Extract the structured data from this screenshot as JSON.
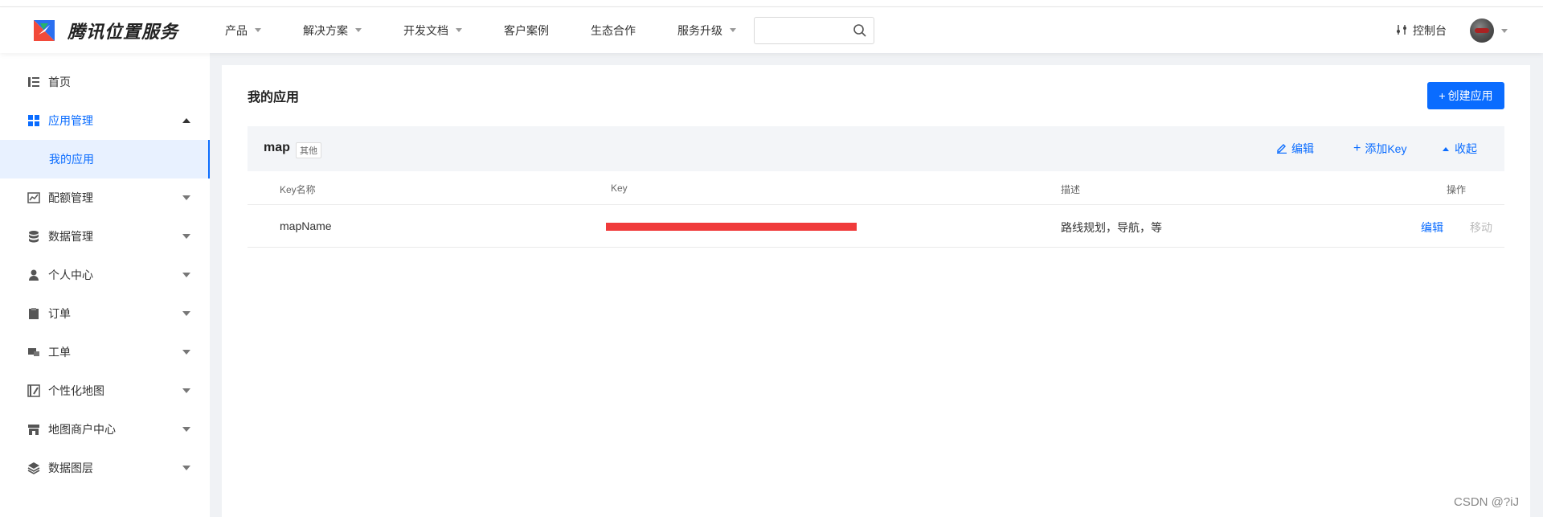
{
  "header": {
    "brand": "腾讯位置服务",
    "nav": [
      {
        "label": "产品",
        "dropdown": true
      },
      {
        "label": "解决方案",
        "dropdown": true
      },
      {
        "label": "开发文档",
        "dropdown": true
      },
      {
        "label": "客户案例",
        "dropdown": false
      },
      {
        "label": "生态合作",
        "dropdown": false
      },
      {
        "label": "服务升级",
        "dropdown": true
      }
    ],
    "search_value": "",
    "console_label": "控制台"
  },
  "sidebar": {
    "items": [
      {
        "label": "首页",
        "icon": "list-icon"
      },
      {
        "label": "应用管理",
        "icon": "grid-icon"
      },
      {
        "label": "我的应用"
      },
      {
        "label": "配额管理",
        "icon": "chart-icon"
      },
      {
        "label": "数据管理",
        "icon": "database-icon"
      },
      {
        "label": "个人中心",
        "icon": "user-icon"
      },
      {
        "label": "订单",
        "icon": "clipboard-icon"
      },
      {
        "label": "工单",
        "icon": "ticket-icon"
      },
      {
        "label": "个性化地图",
        "icon": "map-style-icon"
      },
      {
        "label": "地图商户中心",
        "icon": "store-icon"
      },
      {
        "label": "数据图层",
        "icon": "layers-icon"
      }
    ]
  },
  "main": {
    "title": "我的应用",
    "create_label": "创建应用",
    "app": {
      "name": "map",
      "tag": "其他",
      "edit_label": "编辑",
      "add_key_label": "添加Key",
      "collapse_label": "收起"
    },
    "table": {
      "headers": [
        "Key名称",
        "Key",
        "描述",
        "操作"
      ],
      "rows": [
        {
          "name": "mapName",
          "key_redacted": true,
          "desc": "路线规划，导航，等",
          "action_edit": "编辑",
          "action_move": "移动"
        }
      ]
    }
  },
  "watermark": "CSDN @?іJ",
  "colors": {
    "accent": "#0a6cff",
    "redaction": "#f03b3b"
  }
}
